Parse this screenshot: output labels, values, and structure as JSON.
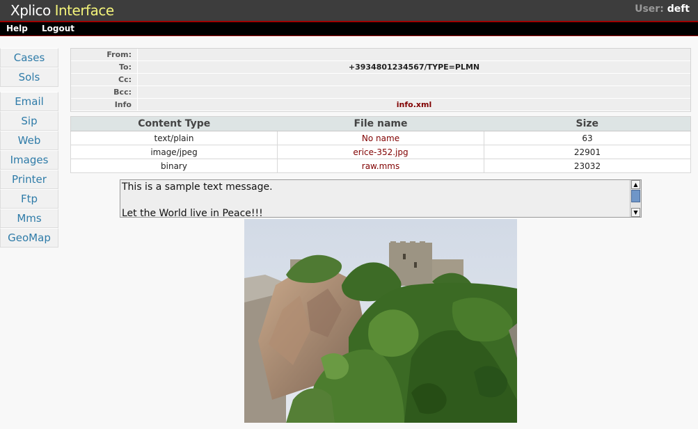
{
  "header": {
    "logo_part1": "Xplico",
    "logo_part2": "Interface",
    "user_label": "User:",
    "user_name": "deft"
  },
  "menu": {
    "help": "Help",
    "logout": "Logout"
  },
  "sidebar": {
    "group1": [
      "Cases",
      "Sols"
    ],
    "group2": [
      "Email",
      "Sip",
      "Web",
      "Images",
      "Printer",
      "Ftp",
      "Mms",
      "GeoMap"
    ]
  },
  "message_header": {
    "from_label": "From:",
    "from_value": "",
    "to_label": "To:",
    "to_value": "+3934801234567/TYPE=PLMN",
    "cc_label": "Cc:",
    "cc_value": "",
    "bcc_label": "Bcc:",
    "bcc_value": "",
    "info_label": "Info",
    "info_value": "info.xml"
  },
  "parts": {
    "columns": [
      "Content Type",
      "File name",
      "Size"
    ],
    "rows": [
      {
        "type": "text/plain",
        "file": "No name",
        "size": "63"
      },
      {
        "type": "image/jpeg",
        "file": "erice-352.jpg",
        "size": "22901"
      },
      {
        "type": "binary",
        "file": "raw.mms",
        "size": "23032"
      }
    ]
  },
  "message_text": {
    "line1": "This is a sample text message.",
    "line2": "",
    "line3": "Let the World live in Peace!!!"
  },
  "colors": {
    "header_bg": "#3d3d3d",
    "accent_red": "#a00000",
    "link_color": "#800000",
    "sidebar_text": "#2e7ba8",
    "logo_yellow": "#f3f37a"
  }
}
